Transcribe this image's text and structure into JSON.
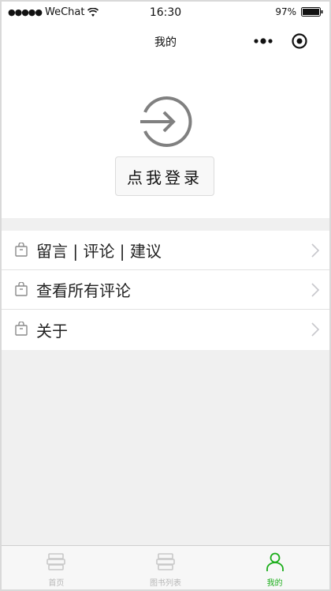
{
  "status_bar": {
    "signal": "●●●●●",
    "carrier": "WeChat",
    "time": "16:30",
    "battery": "97%"
  },
  "nav": {
    "title": "我的"
  },
  "login": {
    "button_label": "点我登录"
  },
  "menu": {
    "items": [
      {
        "label": "留言 | 评论 | 建议"
      },
      {
        "label": "查看所有评论"
      },
      {
        "label": "关于"
      }
    ]
  },
  "tabs": [
    {
      "label": "首页",
      "icon": "books-icon",
      "active": false
    },
    {
      "label": "图书列表",
      "icon": "books-icon",
      "active": false
    },
    {
      "label": "我的",
      "icon": "user-icon",
      "active": true
    }
  ],
  "colors": {
    "accent": "#1aad19",
    "inactive": "#b8b8b8",
    "background": "#f0f0f0"
  }
}
